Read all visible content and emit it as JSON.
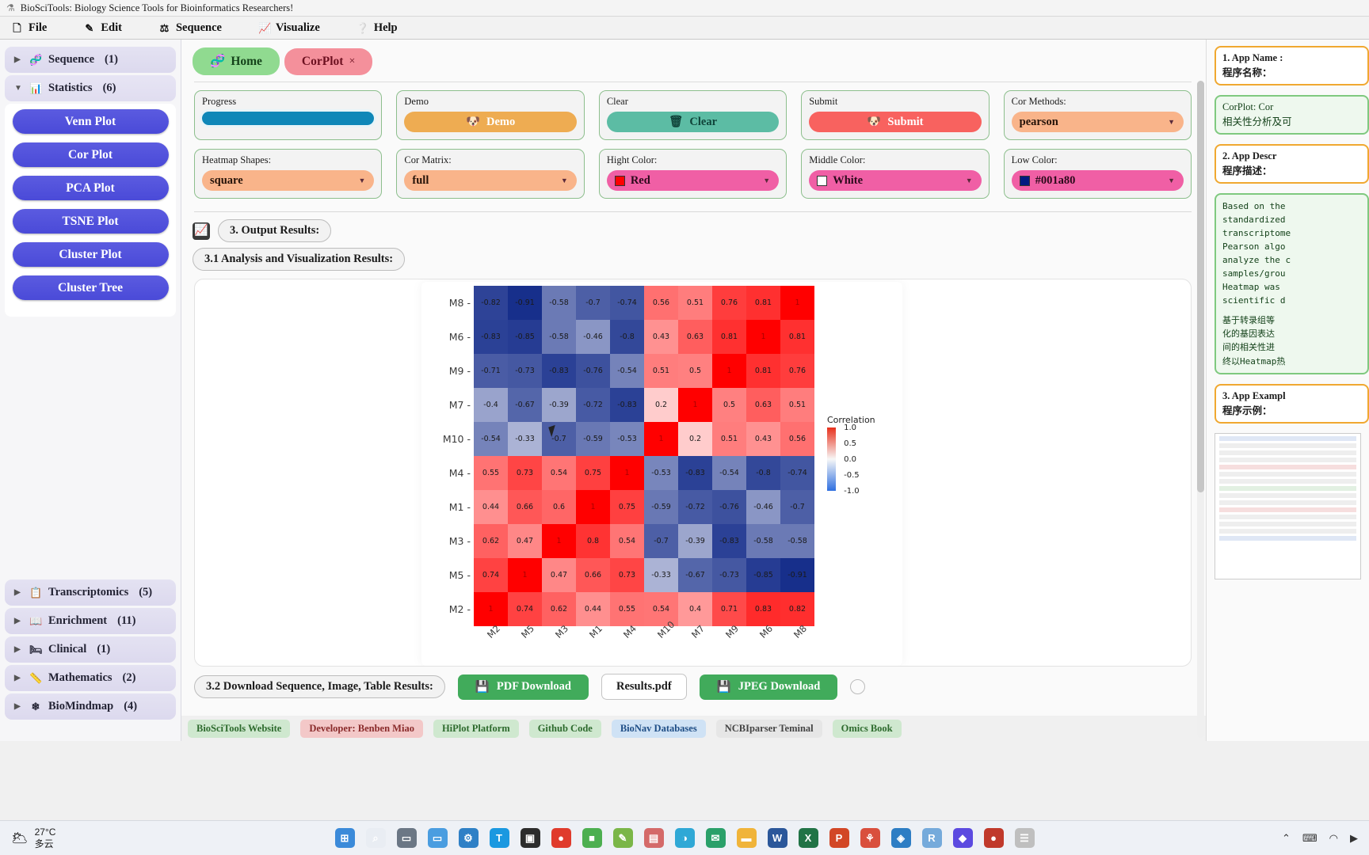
{
  "window": {
    "title": "BioSciTools: Biology Science Tools for Bioinformatics Researchers!",
    "icon": "dna-icon"
  },
  "menubar": [
    {
      "label": "File",
      "icon": "file-icon"
    },
    {
      "label": "Edit",
      "icon": "pencil-icon"
    },
    {
      "label": "Sequence",
      "icon": "dna-icon"
    },
    {
      "label": "Visualize",
      "icon": "chart-icon"
    },
    {
      "label": "Help",
      "icon": "question-icon"
    }
  ],
  "sidebar": {
    "categories": [
      {
        "label": "Sequence",
        "count": "(1)",
        "icon": "dna-icon",
        "expanded": false
      },
      {
        "label": "Statistics",
        "count": "(6)",
        "icon": "stats-icon",
        "expanded": true
      }
    ],
    "statistics_tools": [
      "Venn Plot",
      "Cor Plot",
      "PCA Plot",
      "TSNE Plot",
      "Cluster Plot",
      "Cluster Tree"
    ],
    "bottom_categories": [
      {
        "label": "Transcriptomics",
        "count": "(5)",
        "icon": "transcript-icon"
      },
      {
        "label": "Enrichment",
        "count": "(11)",
        "icon": "book-icon"
      },
      {
        "label": "Clinical",
        "count": "(1)",
        "icon": "medkit-icon"
      },
      {
        "label": "Mathematics",
        "count": "(2)",
        "icon": "math-icon"
      },
      {
        "label": "BioMindmap",
        "count": "(4)",
        "icon": "mindmap-icon"
      }
    ]
  },
  "tabs": [
    {
      "label": "Home",
      "icon": "dna-icon",
      "closable": false
    },
    {
      "label": "CorPlot",
      "icon": "",
      "closable": true,
      "close_glyph": "×"
    }
  ],
  "controls": {
    "row1": [
      {
        "label": "Progress",
        "type": "progress",
        "value": "100",
        "color": "#0f87b8"
      },
      {
        "label": "Demo",
        "type": "button",
        "value": "Demo",
        "icon": "dog-icon",
        "color": "#eeac52"
      },
      {
        "label": "Clear",
        "type": "button",
        "value": "Clear",
        "icon": "trash-icon",
        "color": "#5cbca4"
      },
      {
        "label": "Submit",
        "type": "button",
        "value": "Submit",
        "icon": "dog-icon",
        "color": "#f8625f"
      },
      {
        "label": "Cor Methods:",
        "type": "select",
        "value": "pearson",
        "color": "#f9b48a"
      }
    ],
    "row2": [
      {
        "label": "Heatmap Shapes:",
        "type": "select",
        "value": "square",
        "color": "#f9b48a"
      },
      {
        "label": "Cor Matrix:",
        "type": "select",
        "value": "full",
        "color": "#f9b48a"
      },
      {
        "label": "Hight Color:",
        "type": "select",
        "value": "Red",
        "swatch": "#ff0000",
        "color": "#f05fa5"
      },
      {
        "label": "Middle Color:",
        "type": "select",
        "value": "White",
        "swatch": "#ffffff",
        "color": "#f05fa5"
      },
      {
        "label": "Low Color:",
        "type": "select",
        "value": "#001a80",
        "swatch": "#001a80",
        "color": "#f05fa5"
      }
    ]
  },
  "sections": {
    "output_results": "3. Output Results:",
    "analysis": "3.1 Analysis and Visualization Results:",
    "download": "3.2 Download Sequence, Image, Table Results:"
  },
  "downloads": {
    "pdf_label": "PDF Download",
    "file_label": "Results.pdf",
    "jpeg_label": "JPEG Download",
    "pdf_icon": "save-icon",
    "jpeg_icon": "save-icon"
  },
  "footer_links": [
    {
      "label": "BioSciTools Website",
      "bg": "#cfe8cf",
      "fg": "#2e6b2e"
    },
    {
      "label": "Developer: Benben Miao",
      "bg": "#f3c8c8",
      "fg": "#8a2b2b"
    },
    {
      "label": "HiPlot Platform",
      "bg": "#cfe8cf",
      "fg": "#2e6b2e"
    },
    {
      "label": "Github Code",
      "bg": "#cfe8cf",
      "fg": "#2e6b2e"
    },
    {
      "label": "BioNav Databases",
      "bg": "#cfe2f5",
      "fg": "#1f4e86"
    },
    {
      "label": "NCBIparser Teminal",
      "bg": "#e6e6e6",
      "fg": "#444444"
    },
    {
      "label": "Omics Book",
      "bg": "#cfe8cf",
      "fg": "#2e6b2e"
    }
  ],
  "right_panel": {
    "app_name_title": "1. App  Name :",
    "app_name_title_cn": "程序名称：",
    "app_name_value": "CorPlot: Cor",
    "app_name_value_cn": "相关性分析及可",
    "app_desc_title": "2. App  Descr",
    "app_desc_title_cn": "程序描述：",
    "app_desc_en": "Based on the \nstandardized \ntranscriptome\nPearson algo\nanalyze the c\nsamples/grou\nHeatmap was \nscientific d",
    "app_desc_cn": "基于转录组等\n化的基因表达\n间的相关性进\n终以Heatmap热",
    "app_example_title": "3. App  Exampl",
    "app_example_title_cn": "程序示例："
  },
  "chart_data": {
    "type": "heatmap",
    "title": "",
    "legend_title": "Correlation",
    "legend_ticks": [
      "1.0",
      "0.5",
      "0.0",
      "-0.5",
      "-1.0"
    ],
    "colorscale": {
      "high": "#ff0000",
      "mid": "#ffffff",
      "low": "#001a80"
    },
    "x": [
      "M2",
      "M5",
      "M3",
      "M1",
      "M4",
      "M10",
      "M7",
      "M9",
      "M6",
      "M8"
    ],
    "y": [
      "M8",
      "M6",
      "M9",
      "M7",
      "M10",
      "M4",
      "M1",
      "M3",
      "M5",
      "M2"
    ],
    "z": [
      [
        -0.82,
        -0.91,
        -0.58,
        -0.7,
        -0.74,
        0.56,
        0.51,
        0.76,
        0.81,
        1
      ],
      [
        -0.83,
        -0.85,
        -0.58,
        -0.46,
        -0.8,
        0.43,
        0.63,
        0.81,
        1,
        0.81
      ],
      [
        -0.71,
        -0.73,
        -0.83,
        -0.76,
        -0.54,
        0.51,
        0.5,
        1,
        0.81,
        0.76
      ],
      [
        -0.4,
        -0.67,
        -0.39,
        -0.72,
        -0.83,
        0.2,
        1,
        0.5,
        0.63,
        0.51
      ],
      [
        -0.54,
        -0.33,
        -0.7,
        -0.59,
        -0.53,
        1,
        0.2,
        0.51,
        0.43,
        0.56
      ],
      [
        0.55,
        0.73,
        0.54,
        0.75,
        1,
        -0.53,
        -0.83,
        -0.54,
        -0.8,
        -0.74
      ],
      [
        0.44,
        0.66,
        0.6,
        1,
        0.75,
        -0.59,
        -0.72,
        -0.76,
        -0.46,
        -0.7
      ],
      [
        0.62,
        0.47,
        1,
        0.8,
        0.54,
        -0.7,
        -0.39,
        -0.83,
        -0.58,
        -0.58
      ],
      [
        0.74,
        1,
        0.47,
        0.66,
        0.73,
        -0.33,
        -0.67,
        -0.73,
        -0.85,
        -0.91
      ],
      [
        1,
        0.74,
        0.62,
        0.44,
        0.55,
        0.54,
        0.4,
        0.71,
        0.83,
        0.82
      ]
    ],
    "zlim": [
      -1,
      1
    ]
  },
  "taskbar": {
    "temperature": "27°C",
    "condition": "多云",
    "weather_icon": "cloud-icon",
    "apps": [
      {
        "name": "start-icon",
        "glyph": "⊞",
        "bg": "#3b8ad9"
      },
      {
        "name": "search-icon",
        "glyph": "⌕",
        "bg": "#e9edf3"
      },
      {
        "name": "taskview-icon",
        "glyph": "▭",
        "bg": "#6b7785"
      },
      {
        "name": "chat-icon",
        "glyph": "▭",
        "bg": "#4a9de0"
      },
      {
        "name": "settings-icon",
        "glyph": "⚙",
        "bg": "#2f80c6"
      },
      {
        "name": "tim-icon",
        "glyph": "T",
        "bg": "#1a98e0"
      },
      {
        "name": "terminal-icon",
        "glyph": "▣",
        "bg": "#2c2c2c"
      },
      {
        "name": "chrome-icon",
        "glyph": "●",
        "bg": "#e03b2c"
      },
      {
        "name": "folder-icon",
        "glyph": "■",
        "bg": "#4caf50"
      },
      {
        "name": "note-icon",
        "glyph": "✎",
        "bg": "#7ab648"
      },
      {
        "name": "store-icon",
        "glyph": "▤",
        "bg": "#d46a6a"
      },
      {
        "name": "edge-icon",
        "glyph": "◑",
        "bg": "#2fa8d6"
      },
      {
        "name": "mail-icon",
        "glyph": "✉",
        "bg": "#2aa06a"
      },
      {
        "name": "files-icon",
        "glyph": "▬",
        "bg": "#f0b43a"
      },
      {
        "name": "word-icon",
        "glyph": "W",
        "bg": "#2b579a"
      },
      {
        "name": "excel-icon",
        "glyph": "X",
        "bg": "#217346"
      },
      {
        "name": "powerpoint-icon",
        "glyph": "P",
        "bg": "#d24726"
      },
      {
        "name": "bio-icon",
        "glyph": "⚘",
        "bg": "#d94f3d"
      },
      {
        "name": "vscode-icon",
        "glyph": "◈",
        "bg": "#2d7dc4"
      },
      {
        "name": "rstudio-icon",
        "glyph": "R",
        "bg": "#75aadb"
      },
      {
        "name": "code-icon",
        "glyph": "◆",
        "bg": "#5b4ae0"
      },
      {
        "name": "alert-icon",
        "glyph": "●",
        "bg": "#c0392b"
      },
      {
        "name": "app-icon",
        "glyph": "☰",
        "bg": "#bfbfbf"
      }
    ],
    "tray": [
      {
        "name": "chevron-up-icon",
        "glyph": "⌃"
      },
      {
        "name": "keyboard-icon",
        "glyph": "⌨"
      },
      {
        "name": "wifi-icon",
        "glyph": "◠"
      },
      {
        "name": "volume-icon",
        "glyph": "▶"
      }
    ]
  }
}
